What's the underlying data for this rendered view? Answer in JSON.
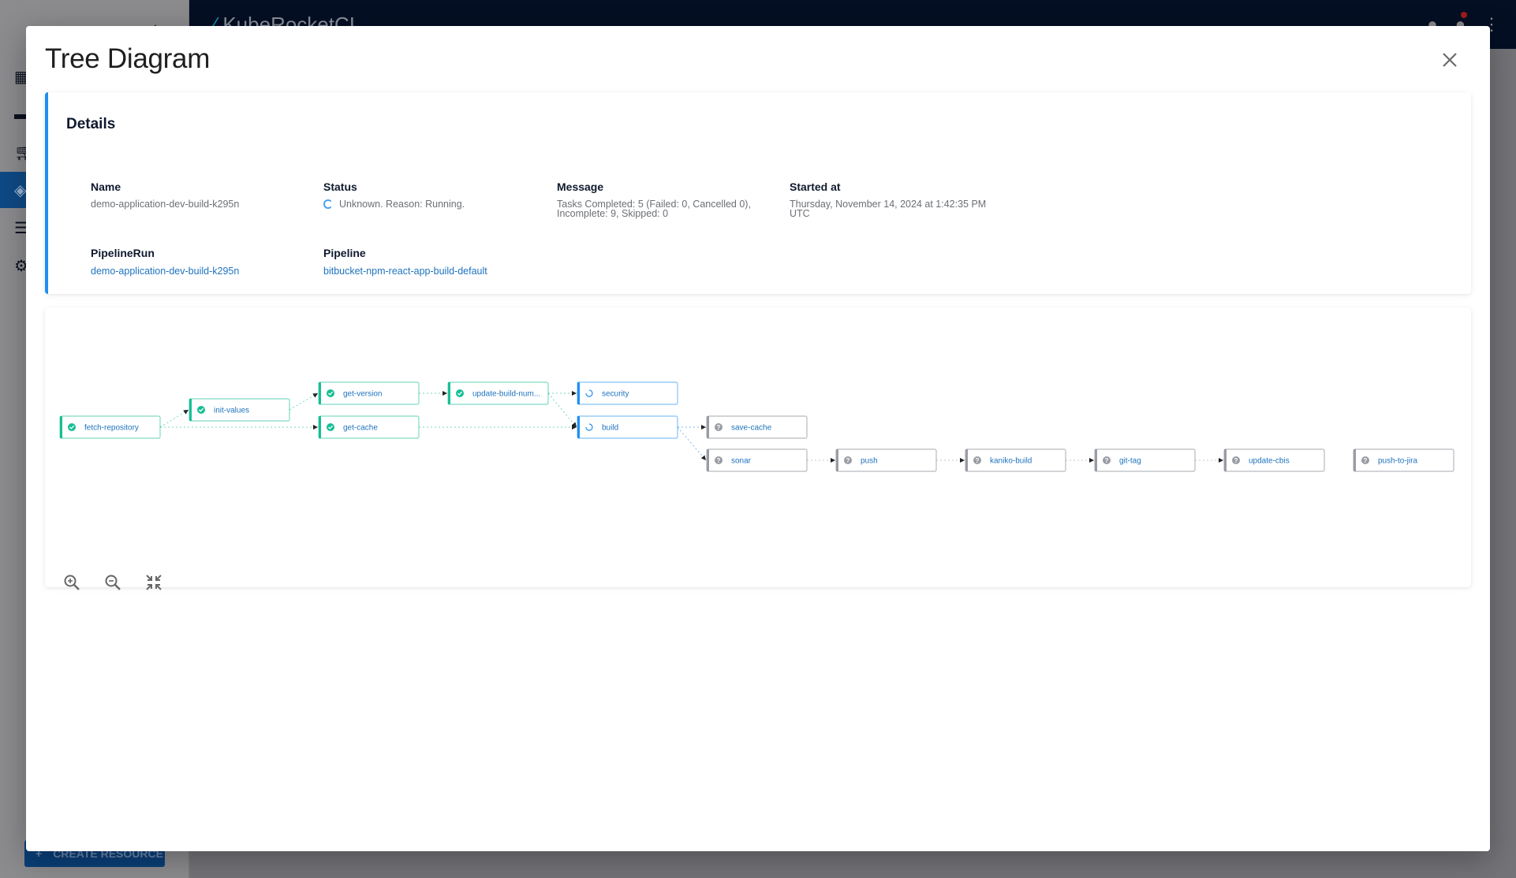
{
  "background": {
    "brand": "KubeRocketCI",
    "create_resource_label": "CREATE RESOURCE",
    "sidebar_icons": [
      "dashboard-icon",
      "flag-icon",
      "cart-icon",
      "layers-icon",
      "storage-icon",
      "gear-icon"
    ],
    "active_sidebar_index": 3
  },
  "modal": {
    "title": "Tree Diagram",
    "close_label": "Close",
    "details": {
      "title": "Details",
      "name_label": "Name",
      "name_value": "demo-application-dev-build-k295n",
      "status_label": "Status",
      "status_value": "Unknown. Reason: Running.",
      "message_label": "Message",
      "message_line1": "Tasks Completed: 5 (Failed: 0, Cancelled 0),",
      "message_line2": "Incomplete: 9, Skipped: 0",
      "started_label": "Started at",
      "started_line1": "Thursday, November 14, 2024 at 1:42:35 PM",
      "started_line2": "UTC",
      "pipelinerun_label": "PipelineRun",
      "pipelinerun_value": "demo-application-dev-build-k295n",
      "pipeline_label": "Pipeline",
      "pipeline_value": "bitbucket-npm-react-app-build-default"
    },
    "diagram": {
      "status_colors": {
        "succeeded": "#18be94",
        "running": "#1f8ff0",
        "unknown": "#9a9ca4"
      },
      "nodes": [
        {
          "id": "fetch-repository",
          "label": "fetch-repository",
          "status": "succeeded"
        },
        {
          "id": "init-values",
          "label": "init-values",
          "status": "succeeded"
        },
        {
          "id": "get-version",
          "label": "get-version",
          "status": "succeeded"
        },
        {
          "id": "get-cache",
          "label": "get-cache",
          "status": "succeeded"
        },
        {
          "id": "update-build-number",
          "label": "update-build-num...",
          "status": "succeeded"
        },
        {
          "id": "security",
          "label": "security",
          "status": "running"
        },
        {
          "id": "build",
          "label": "build",
          "status": "running"
        },
        {
          "id": "save-cache",
          "label": "save-cache",
          "status": "unknown"
        },
        {
          "id": "sonar",
          "label": "sonar",
          "status": "unknown"
        },
        {
          "id": "push",
          "label": "push",
          "status": "unknown"
        },
        {
          "id": "kaniko-build",
          "label": "kaniko-build",
          "status": "unknown"
        },
        {
          "id": "git-tag",
          "label": "git-tag",
          "status": "unknown"
        },
        {
          "id": "update-cbis",
          "label": "update-cbis",
          "status": "unknown"
        },
        {
          "id": "push-to-jira",
          "label": "push-to-jira",
          "status": "unknown"
        }
      ],
      "edges": [
        [
          "fetch-repository",
          "init-values"
        ],
        [
          "fetch-repository",
          "get-cache"
        ],
        [
          "init-values",
          "get-version"
        ],
        [
          "get-version",
          "update-build-number"
        ],
        [
          "get-cache",
          "build"
        ],
        [
          "update-build-number",
          "security"
        ],
        [
          "update-build-number",
          "build"
        ],
        [
          "build",
          "save-cache"
        ],
        [
          "build",
          "sonar"
        ],
        [
          "sonar",
          "push"
        ],
        [
          "push",
          "kaniko-build"
        ],
        [
          "kaniko-build",
          "git-tag"
        ],
        [
          "git-tag",
          "update-cbis"
        ]
      ],
      "controls": {
        "zoom_in": "zoom-in-icon",
        "zoom_out": "zoom-out-icon",
        "fit": "fit-screen-icon"
      }
    }
  }
}
